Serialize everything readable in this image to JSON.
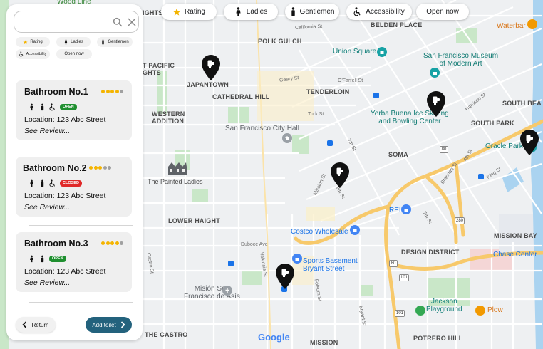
{
  "filters": {
    "rating": "Rating",
    "ladies": "Ladies",
    "gentlemen": "Gentlemen",
    "accessibility": "Accessibility",
    "open_now": "Open now"
  },
  "panel": {
    "search": {
      "placeholder": "",
      "value": ""
    },
    "mini_filters": {
      "rating": "Rating",
      "ladies": "Ladies",
      "gentlemen": "Gentlemen",
      "accessibility": "Accessibility",
      "open_now": "Open now"
    },
    "bathrooms": [
      {
        "name": "Bathroom No.1",
        "rating": 4,
        "max_rating": 5,
        "status": "OPEN",
        "accessible": true,
        "location": "Location: 123 Abc Street",
        "review_link": "See Review..."
      },
      {
        "name": "Bathroom No.2",
        "rating": 3,
        "max_rating": 5,
        "status": "CLOSED",
        "accessible": true,
        "location": "Location: 123 Abc Street",
        "review_link": "See Review..."
      },
      {
        "name": "Bathroom No.3",
        "rating": 4,
        "max_rating": 5,
        "status": "OPEN",
        "accessible": false,
        "location": "Location: 123 Abc Street",
        "review_link": "See Review..."
      }
    ],
    "return_label": "Return",
    "add_label": "Add toilet"
  },
  "map": {
    "districts": {
      "polk_gulch": "POLK GULCH",
      "japantown": "JAPANTOWN",
      "cathedral_hill": "CATHEDRAL HILL",
      "tenderloin": "TENDERLOIN",
      "western_addition": "WESTERN\nADDITION",
      "soma": "SOMA",
      "south_park": "SOUTH PARK",
      "south_beach": "SOUTH BEA",
      "lower_haight": "LOWER HAIGHT",
      "mission_bay": "MISSION BAY",
      "design_district": "DESIGN DISTRICT",
      "potrero_hill": "POTRERO HILL",
      "mission": "MISSION",
      "the_castro": "THE CASTRO",
      "belden_place": "BELDEN PLACE",
      "pacific_heights": "GHTS",
      "pacific_heights2": "T PACIFIC\nGHTS",
      "heights_top": "IGHTS",
      "wood_line": "Wood Line"
    },
    "pois": {
      "union_square": "Union Square",
      "sf_museum": "San Francisco Museum\nof Modern Art",
      "yerba_buena": "Yerba Buena Ice Skating\nand Bowling Center",
      "city_hall": "San Francisco City Hall",
      "painted_ladies": "The Painted Ladies",
      "oracle_park": "Oracle Park",
      "costco": "Costco Wholesale",
      "sports_basement": "Sports Basement\nBryant Street",
      "rei": "REI",
      "chase_center": "Chase Center",
      "mision_san_francisco": "Misión San\nFrancisco de Asís",
      "jackson_playground": "Jackson\nPlayground",
      "plow": "Plow",
      "waterbar": "Waterbar"
    },
    "streets": {
      "california": "California St",
      "california2": "California St",
      "geary": "Geary St",
      "ofarrell": "O'Farrell St",
      "turk": "Turk St",
      "mission": "Mission St",
      "ninth": "9th St",
      "seventh": "7th St",
      "seventh2": "7th St",
      "fourth": "4th St",
      "brannan": "Brannan St",
      "king": "King St",
      "harrison": "Harrison St",
      "duboce": "Duboce Ave",
      "valencia": "Valencia St",
      "folsom": "Folsom St",
      "bryant": "Bryant St",
      "castro": "Castro St",
      "howard": "Howard St"
    },
    "highways": {
      "h80a": "80",
      "h80b": "80",
      "h280": "280",
      "h101a": "101",
      "h101b": "101"
    },
    "google": "Google",
    "colors": {
      "map_bg": "#eef0f2",
      "park": "#c9e7c8",
      "highway": "#f7c96b",
      "water": "#aad3f0",
      "pin": "#111111",
      "brand": "#23627d",
      "star": "#f4b400"
    }
  }
}
